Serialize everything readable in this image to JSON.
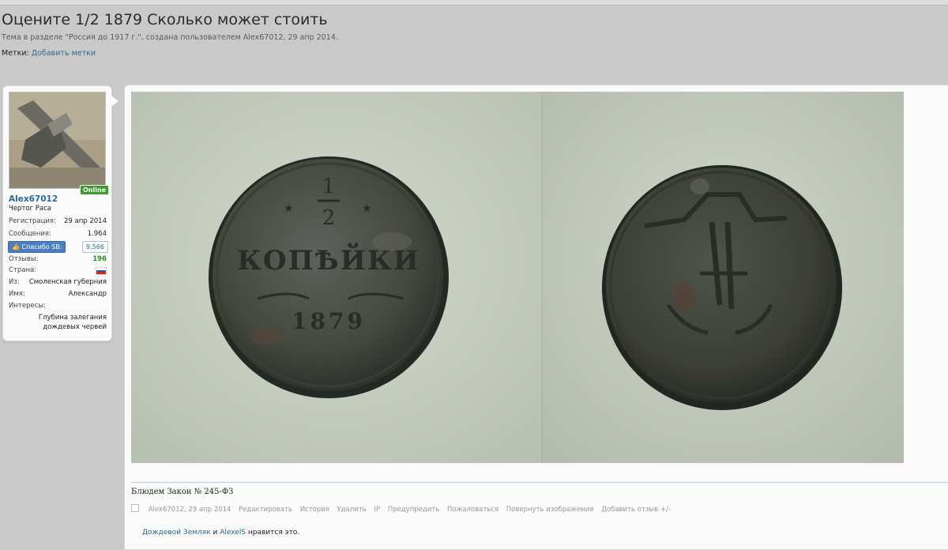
{
  "thread": {
    "title": "Оцените 1/2 1879 Сколько может стоить",
    "subtitle": "Тема в разделе \"Россия до 1917 г.\", создана пользователем Alex67012, 29 апр 2014.",
    "tags_label": "Метки:",
    "tags_link": "Добавить метки"
  },
  "user": {
    "online_badge": "Online",
    "name": "Alex67012",
    "title": "Чертог Раса",
    "reg_label": "Регистрация:",
    "reg_value": "29 апр 2014",
    "msgs_label": "Сообщения:",
    "msgs_value": "1.964",
    "thanks_btn": "Спасибо SB:",
    "thanks_value": "9.566",
    "reviews_label": "Отзывы:",
    "reviews_value": "196",
    "country_label": "Страна:",
    "from_label": "Из:",
    "from_value": "Смоленская губерния",
    "name_label": "Имя:",
    "name_value": "Александр",
    "interests_label": "Интересы:",
    "interests_value": "Глубина залегания дождевых червей"
  },
  "post": {
    "coin_obverse_text": "1/2 КОПѢЙКИ",
    "coin_year": "1879",
    "signature": "Блюдем Закон № 245-ФЗ",
    "actions": [
      "Alex67012, 29 апр 2014",
      "Редактировать",
      "История",
      "Удалить",
      "IP",
      "Предупредить",
      "Пожаловаться",
      "Повернуть изображение",
      "Добавить отзыв +/-"
    ],
    "likes": {
      "user1": "Дождевой Земляк",
      "and": " и ",
      "user2": "AlexelS",
      "suffix": " нравится это."
    }
  },
  "colors": {
    "link": "#2b6a9a",
    "online": "#3d9a2f",
    "positive": "#2a8b23"
  }
}
